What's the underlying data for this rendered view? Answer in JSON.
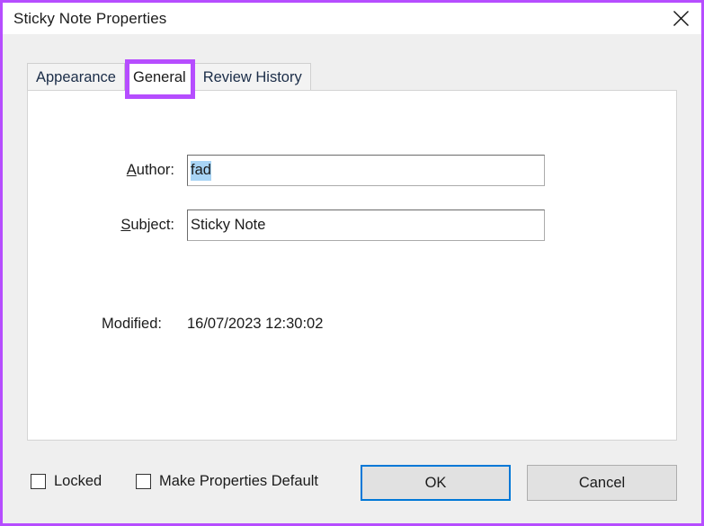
{
  "window": {
    "title": "Sticky Note Properties",
    "close_icon": "close-icon",
    "highlight_color": "#b64dff"
  },
  "tabs": [
    {
      "label": "Appearance",
      "selected": false
    },
    {
      "label": "General",
      "selected": true
    },
    {
      "label": "Review History",
      "selected": false
    }
  ],
  "general": {
    "author": {
      "label_prefix": "",
      "label_accel": "A",
      "label_rest": "uthor:",
      "value": "fad",
      "placeholder": "",
      "selected": true
    },
    "subject": {
      "label_accel": "S",
      "label_rest": "ubject:",
      "value": "Sticky Note",
      "placeholder": "",
      "selected": false
    },
    "modified": {
      "label": "Modified:",
      "value": "16/07/2023 12:30:02"
    }
  },
  "footer": {
    "locked": {
      "label": "Locked",
      "checked": false
    },
    "make_default": {
      "label": "Make Properties Default",
      "checked": false
    },
    "ok_label": "OK",
    "cancel_label": "Cancel",
    "focus_color": "#0078d7"
  }
}
